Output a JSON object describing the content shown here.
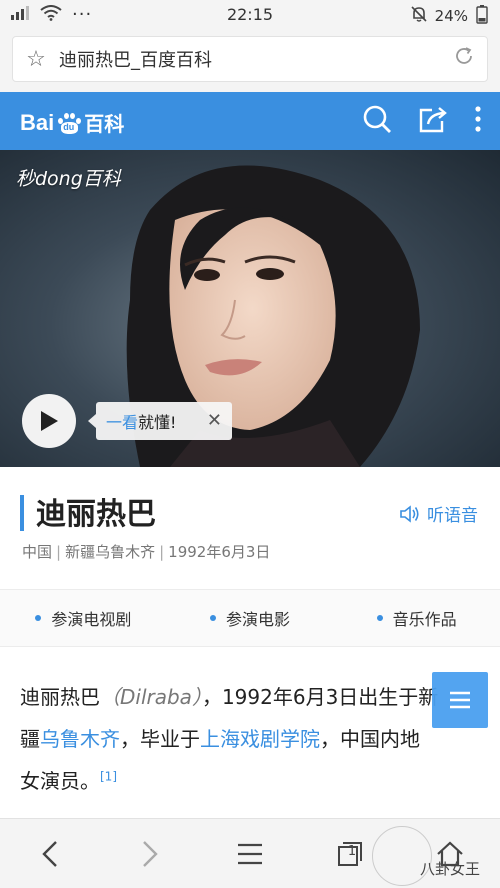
{
  "status_bar": {
    "time": "22:15",
    "battery": "24%"
  },
  "browser": {
    "tab_title": "迪丽热巴_百度百科"
  },
  "baike_header": {
    "logo_text_1": "Bai",
    "logo_text_2": "百科",
    "logo_paw_text": "du"
  },
  "hero": {
    "watermark": "秒dong百科",
    "tip_blue": "一看",
    "tip_rest": "就懂!",
    "tip_close": "✕"
  },
  "title_section": {
    "name": "迪丽热巴",
    "listen_label": "听语音",
    "meta": [
      "中国",
      "新疆乌鲁木齐",
      "1992年6月3日"
    ]
  },
  "tabs": [
    "参演电视剧",
    "参演电影",
    "音乐作品"
  ],
  "content": {
    "p1": "迪丽热巴",
    "p2": "（Dilraba）",
    "p3": "，1992年6月3日出生于新",
    "p4": "疆",
    "link1": "乌鲁木齐",
    "p5": "，毕业于",
    "link2": "上海戏剧学院",
    "p6": "，中国内地",
    "p7": "女演员。",
    "ref": "[1]"
  },
  "bottom_nav": {
    "tabs_count": "1"
  },
  "watermark_text": "八卦女王",
  "colors": {
    "accent": "#3a8fe0"
  }
}
